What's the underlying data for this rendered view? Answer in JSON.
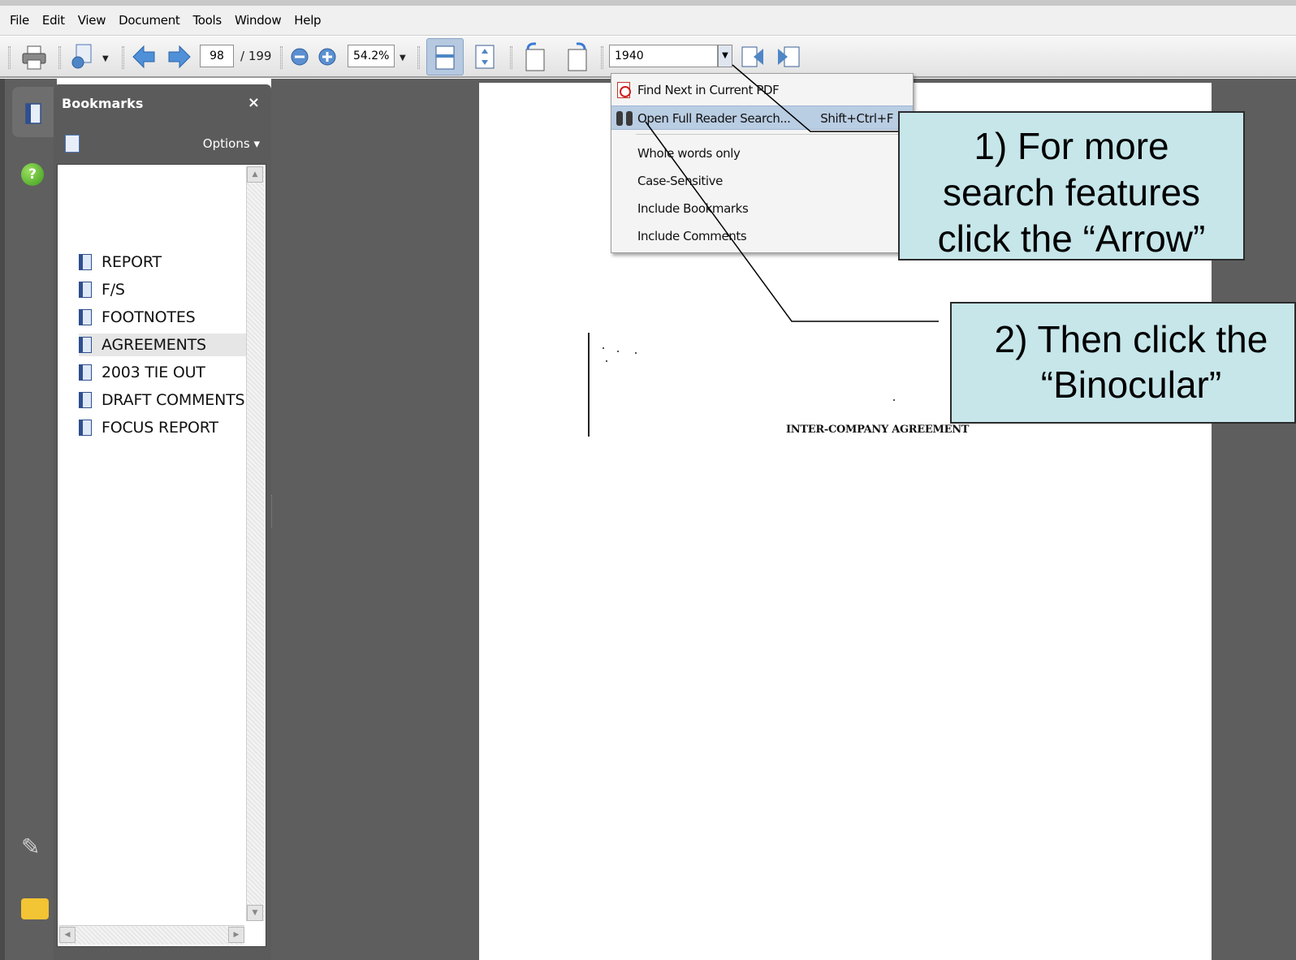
{
  "menubar": {
    "items": [
      "File",
      "Edit",
      "View",
      "Document",
      "Tools",
      "Window",
      "Help"
    ]
  },
  "toolbar": {
    "page_current": "98",
    "page_total": "/ 199",
    "zoom": "54.2%",
    "search_value": "1940"
  },
  "bookmarks": {
    "title": "Bookmarks",
    "close": "×",
    "options": "Options",
    "items": [
      "REPORT",
      "F/S",
      "FOOTNOTES",
      "AGREEMENTS",
      "2003 TIE OUT",
      "DRAFT COMMENTS",
      "FOCUS REPORT"
    ],
    "selected": "AGREEMENTS"
  },
  "search_menu": {
    "find_next": "Find Next in Current PDF",
    "open_full_search": "Open Full Reader Search...",
    "open_full_search_shortcut": "Shift+Ctrl+F",
    "whole_words": "Whole words only",
    "case_sensitive": "Case-Sensitive",
    "include_bookmarks": "Include Bookmarks",
    "include_comments": "Include Comments"
  },
  "document": {
    "heading": "INTER-COMPANY AGREEMENT"
  },
  "callouts": {
    "step1_line1": "1) For more",
    "step1_line2": "search features",
    "step1_line3": "click the “Arrow”",
    "step2_line1": "2) Then click the",
    "step2_line2": "“Binocular”"
  },
  "colors": {
    "callout_fill": "#c6e6ea",
    "panel_dark": "#5b5b5b",
    "menu_highlight": "#b9cde3"
  },
  "icons": [
    "print-icon",
    "share-icon",
    "prev-page-icon",
    "next-page-icon",
    "zoom-out-icon",
    "zoom-in-icon",
    "fit-width-icon",
    "fit-page-icon",
    "rotate-ccw-icon",
    "rotate-cw-icon",
    "find-previous-icon",
    "find-next-icon",
    "bookmarks-panel-icon",
    "help-icon",
    "attachment-icon",
    "comments-icon"
  ]
}
